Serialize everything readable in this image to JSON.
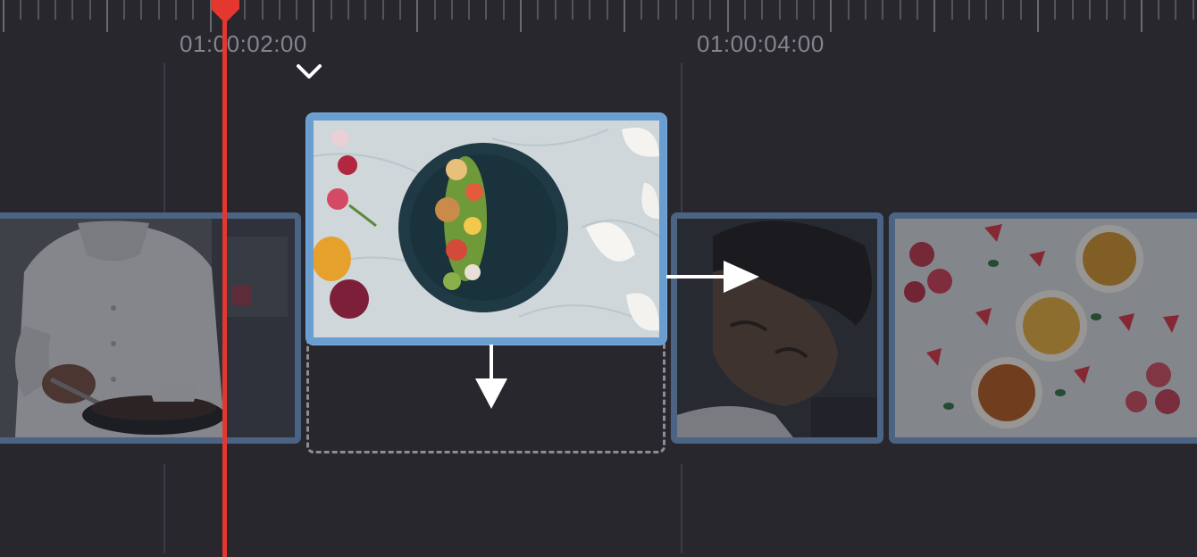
{
  "ruler": {
    "timecodes": [
      "01:00:02:00",
      "01:00:04:00"
    ]
  },
  "colors": {
    "background": "#28272d",
    "playhead": "#e4372f",
    "clip_border": "#4b6484",
    "selected_clip_border": "#6a9ed0",
    "timecode_text": "#85848c"
  },
  "timeline": {
    "clips": [
      {
        "name": "chef-cooking-clip",
        "selected": false
      },
      {
        "name": "plated-dish-clip",
        "selected": true
      },
      {
        "name": "chef-portrait-clip",
        "selected": false
      },
      {
        "name": "creme-brulee-clip",
        "selected": false
      }
    ]
  },
  "icons": {
    "insert_marker": "chevron-down-icon",
    "move_down": "arrow-down-icon",
    "push_right": "arrow-right-icon"
  }
}
